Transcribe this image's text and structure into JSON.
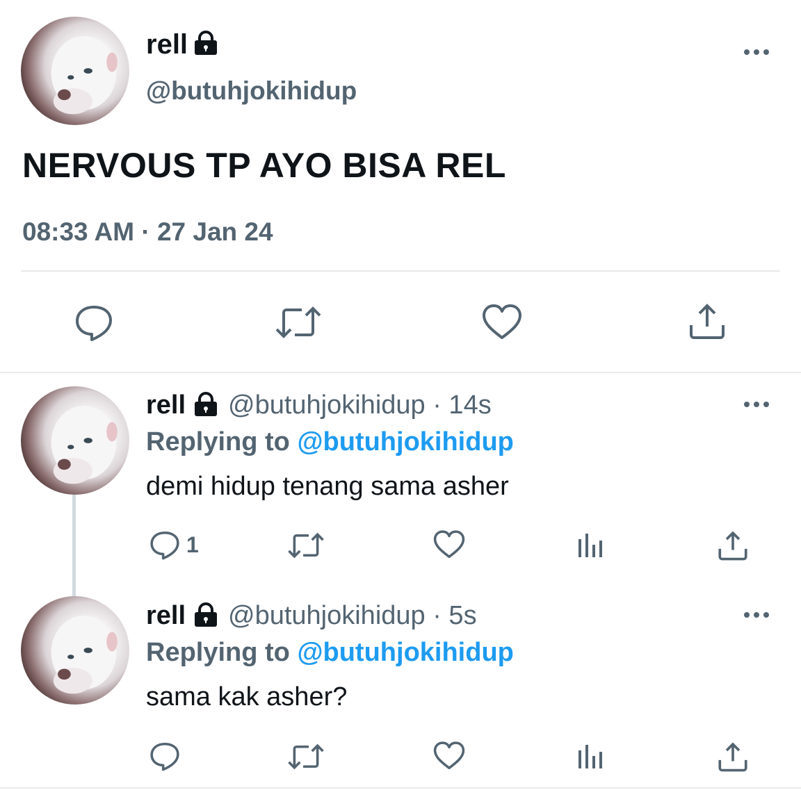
{
  "main_tweet": {
    "name": "rell",
    "handle": "@butuhjokihidup",
    "text": "NERVOUS TP AYO BISA REL",
    "timestamp": "08:33 AM · 27 Jan 24"
  },
  "replies": [
    {
      "name": "rell",
      "handle_time": "@butuhjokihidup · 14s",
      "replying_label": "Replying to ",
      "replying_to": "@butuhjokihidup",
      "text": "demi hidup tenang sama asher",
      "reply_count": "1"
    },
    {
      "name": "rell",
      "handle_time": "@butuhjokihidup · 5s",
      "replying_label": "Replying to ",
      "replying_to": "@butuhjokihidup",
      "text": "sama kak asher?",
      "reply_count": ""
    }
  ],
  "icons": {
    "lock": "lock-icon",
    "more": "more-icon",
    "reply": "reply-icon",
    "retweet": "retweet-icon",
    "like": "heart-icon",
    "views": "views-icon",
    "share": "share-icon"
  },
  "colors": {
    "text": "#0f1419",
    "secondary": "#536471",
    "accent": "#1d9bf0",
    "divider": "#e7e9ea"
  }
}
